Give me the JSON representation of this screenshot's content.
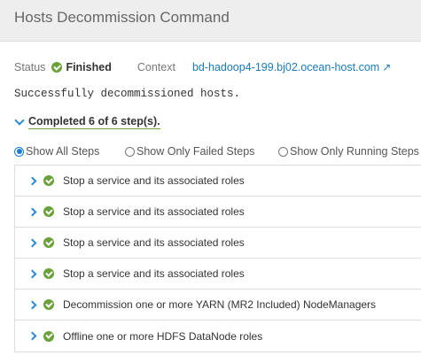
{
  "header": {
    "title": "Hosts Decommission Command"
  },
  "status": {
    "label": "Status",
    "value": "Finished",
    "context_label": "Context",
    "context_link": "bd-hadoop4-199.bj02.ocean-host.com"
  },
  "message": "Successfully decommissioned hosts.",
  "summary": "Completed 6 of 6 step(s).",
  "filters": [
    {
      "label": "Show All Steps",
      "selected": true
    },
    {
      "label": "Show Only Failed Steps",
      "selected": false
    },
    {
      "label": "Show Only Running Steps",
      "selected": false
    }
  ],
  "steps": [
    {
      "label": "Stop a service and its associated roles",
      "status": "success"
    },
    {
      "label": "Stop a service and its associated roles",
      "status": "success"
    },
    {
      "label": "Stop a service and its associated roles",
      "status": "success"
    },
    {
      "label": "Stop a service and its associated roles",
      "status": "success"
    },
    {
      "label": "Decommission one or more YARN (MR2 Included) NodeManagers",
      "status": "success"
    },
    {
      "label": "Offline one or more HDFS DataNode roles",
      "status": "success"
    }
  ],
  "colors": {
    "accent": "#1a7bb9",
    "success": "#6aa13a"
  }
}
